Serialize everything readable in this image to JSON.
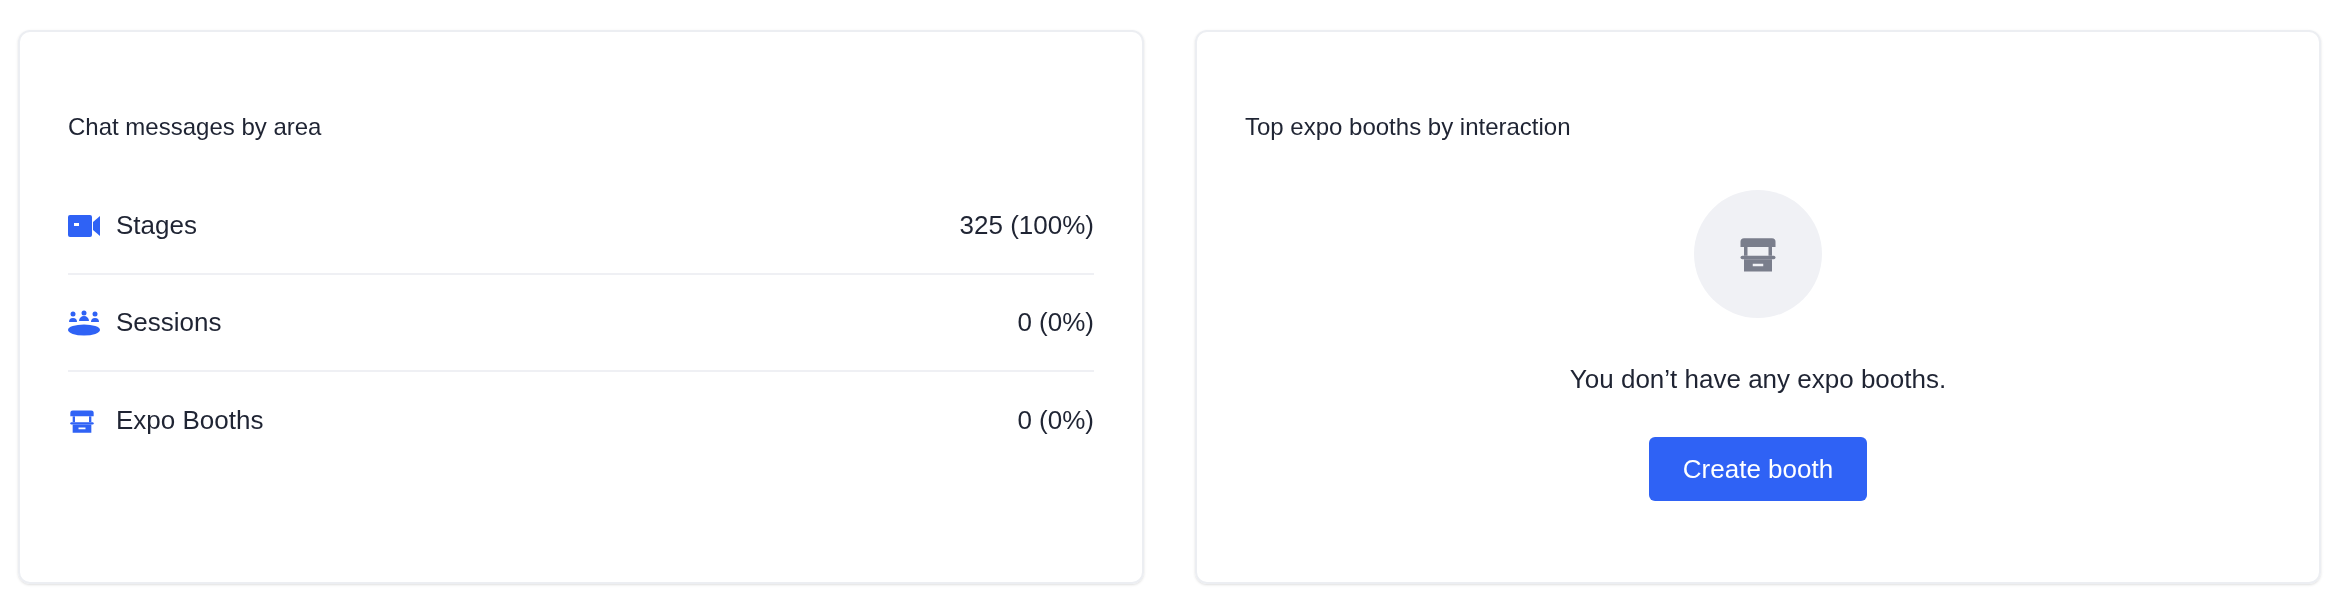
{
  "area_card": {
    "title": "Chat messages by area",
    "rows": [
      {
        "kind": "stages",
        "label": "Stages",
        "value": "325 (100%)"
      },
      {
        "kind": "sessions",
        "label": "Sessions",
        "value": "0 (0%)"
      },
      {
        "kind": "booths",
        "label": "Expo Booths",
        "value": "0 (0%)"
      }
    ]
  },
  "booths_card": {
    "title": "Top expo booths by interaction",
    "empty_message": "You don’t have any expo booths.",
    "button": "Create booth"
  }
}
